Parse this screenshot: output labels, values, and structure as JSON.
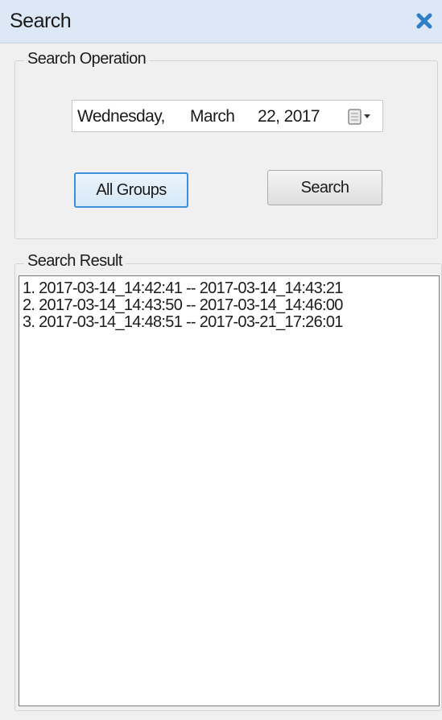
{
  "window": {
    "title": "Search",
    "close_icon": "close-x-icon",
    "accent": "#2f7fc8"
  },
  "search_operation": {
    "label": "Search Operation",
    "date_picker": {
      "day": "Wednesday,",
      "month": "March",
      "date": "22, 2017",
      "dropdown_icon": "calendar-dropdown-icon"
    },
    "all_groups_label": "All Groups",
    "search_label": "Search"
  },
  "search_result": {
    "label": "Search Result",
    "items": [
      "1. 2017-03-14_14:42:41 -- 2017-03-14_14:43:21",
      "2. 2017-03-14_14:43:50 -- 2017-03-14_14:46:00",
      "3. 2017-03-14_14:48:51 -- 2017-03-21_17:26:01"
    ]
  }
}
